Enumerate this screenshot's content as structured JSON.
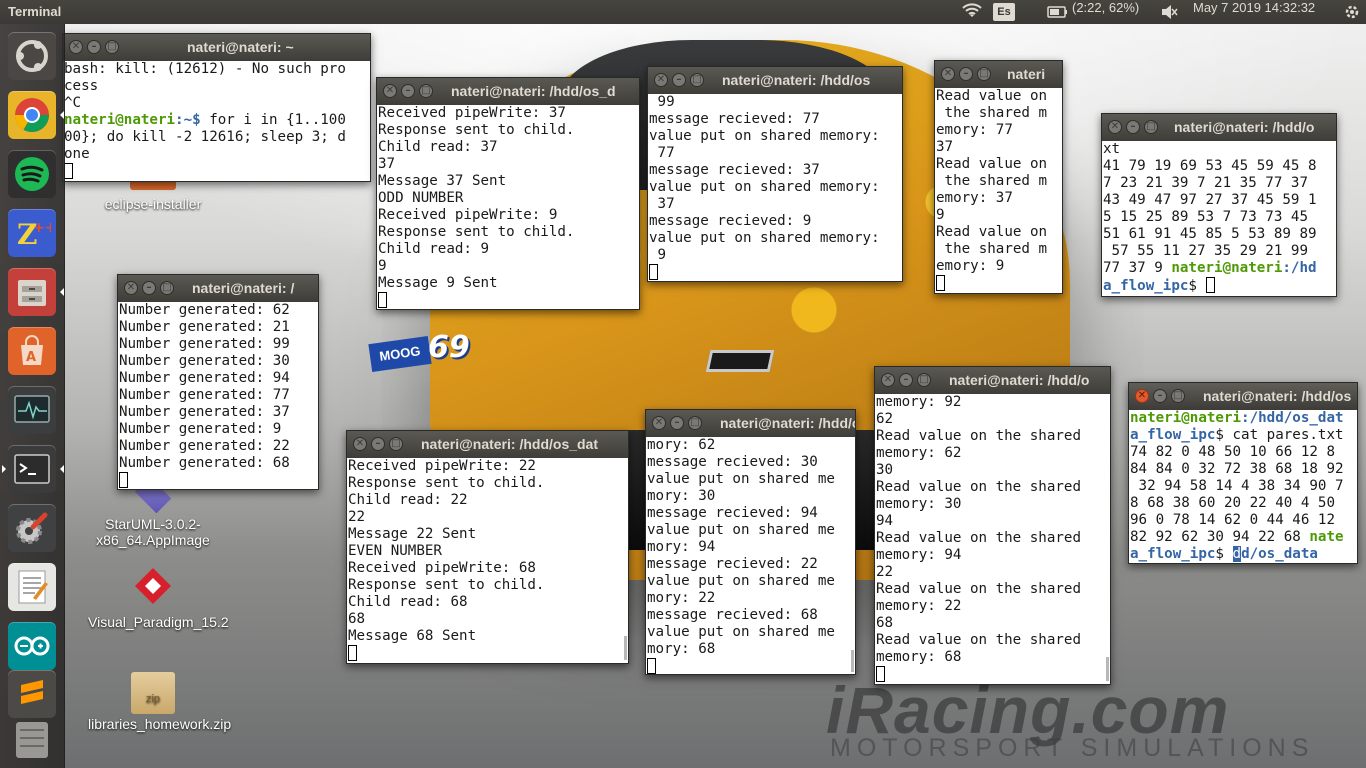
{
  "panel": {
    "app_title": "Terminal",
    "keyboard_layout": "Es",
    "battery": "(2:22, 62%)",
    "datetime": "May 7 2019 14:32:32"
  },
  "launcher": {
    "items": [
      {
        "name": "dash-home",
        "icon": "ubuntu-logo-icon"
      },
      {
        "name": "chrome",
        "icon": "chrome-icon"
      },
      {
        "name": "spotify",
        "icon": "spotify-icon"
      },
      {
        "name": "zplusplus",
        "icon": "zplusplus-icon"
      },
      {
        "name": "files",
        "icon": "file-cabinet-icon"
      },
      {
        "name": "software-center",
        "icon": "shopping-bag-icon"
      },
      {
        "name": "system-monitor",
        "icon": "system-monitor-icon"
      },
      {
        "name": "terminal",
        "icon": "terminal-icon"
      },
      {
        "name": "settings",
        "icon": "settings-wrench-icon"
      },
      {
        "name": "text-editor",
        "icon": "text-editor-icon"
      },
      {
        "name": "arduino",
        "icon": "arduino-icon"
      },
      {
        "name": "sublime",
        "icon": "sublime-icon"
      }
    ]
  },
  "desktop": {
    "icons": [
      {
        "label": "eclipse-installer"
      },
      {
        "label": "StarUML-3.0.2-x86_64.AppImage"
      },
      {
        "label": "Visual_Paradigm_15.2"
      },
      {
        "label": "libraries_homework.zip"
      },
      {
        "label": "zip"
      }
    ],
    "watermark": {
      "brand": "iRacing.com",
      "tagline": "MOTORSPORT SIMULATIONS"
    },
    "car_number": "69",
    "car_sponsor": "MOOG"
  },
  "windows": [
    {
      "title": "nateri@nateri: ~",
      "lines": [
        "bash: kill: (12612) - No such pro",
        "cess",
        "^C"
      ],
      "prompt_user": "nateri@nateri",
      "prompt_path": ":~$",
      "command_lines": [
        " for i in {1..100",
        "00}; do kill -2 12616; sleep 3; d",
        "one"
      ]
    },
    {
      "title": "nateri@nateri: /hdd/os_d",
      "lines": [
        "Received pipeWrite: 37",
        "Response sent to child.",
        "Child read: 37",
        "37",
        "Message 37 Sent",
        "ODD NUMBER",
        "Received pipeWrite: 9",
        "Response sent to child.",
        "Child read: 9",
        "9",
        "Message 9 Sent"
      ]
    },
    {
      "title": "nateri@nateri: /hdd/os",
      "lines": [
        " 99",
        "message recieved: 77",
        "value put on shared memory:",
        " 77",
        "message recieved: 37",
        "value put on shared memory:",
        " 37",
        "message recieved: 9",
        "value put on shared memory:",
        " 9"
      ]
    },
    {
      "title": "nateri",
      "lines": [
        "Read value on",
        " the shared m",
        "emory: 77",
        "37",
        "Read value on",
        " the shared m",
        "emory: 37",
        "9",
        "Read value on",
        " the shared m",
        "emory: 9"
      ]
    },
    {
      "title": "nateri@nateri: /hdd/o",
      "lines": [
        "xt",
        "41 79 19 69 53 45 59 45 8",
        "7 23 21 39 7 21 35 77 37",
        "43 49 47 97 27 37 45 59 1",
        "5 15 25 89 53 7 73 73 45",
        "51 61 91 45 85 5 53 89 89",
        " 57 55 11 27 35 29 21 99",
        "77 37 9 "
      ],
      "prompt_user": "nateri@nateri",
      "prompt_path_1": ":/hd",
      "prompt_path_2": "a_flow_ipc",
      "prompt_end": "$"
    },
    {
      "title": "nateri@nateri: /",
      "lines": [
        "Number generated: 62",
        "Number generated: 21",
        "Number generated: 99",
        "Number generated: 30",
        "Number generated: 94",
        "Number generated: 77",
        "Number generated: 37",
        "Number generated: 9",
        "Number generated: 22",
        "Number generated: 68"
      ]
    },
    {
      "title": "nateri@nateri: /hdd/os_dat",
      "lines": [
        "Received pipeWrite: 22",
        "Response sent to child.",
        "Child read: 22",
        "22",
        "Message 22 Sent",
        "EVEN NUMBER",
        "Received pipeWrite: 68",
        "Response sent to child.",
        "Child read: 68",
        "68",
        "Message 68 Sent"
      ]
    },
    {
      "title": "nateri@nateri: /hdd/o",
      "lines": [
        "mory: 62",
        "message recieved: 30",
        "value put on shared me",
        "mory: 30",
        "message recieved: 94",
        "value put on shared me",
        "mory: 94",
        "message recieved: 22",
        "value put on shared me",
        "mory: 22",
        "message recieved: 68",
        "value put on shared me",
        "mory: 68"
      ]
    },
    {
      "title": "nateri@nateri: /hdd/o",
      "lines": [
        "memory: 92",
        "62",
        "Read value on the shared",
        "memory: 62",
        "30",
        "Read value on the shared",
        "memory: 30",
        "94",
        "Read value on the shared",
        "memory: 94",
        "22",
        "Read value on the shared",
        "memory: 22",
        "68",
        "Read value on the shared",
        "memory: 68"
      ]
    },
    {
      "title": "nateri@nateri: /hdd/os",
      "prompt_user": "nateri@nateri",
      "prompt_path_1": ":/hdd/os_dat",
      "prompt_path_2": "a_flow_ipc",
      "command": " cat pares.txt",
      "lines": [
        "74 82 0 48 50 10 66 12 8",
        "84 84 0 32 72 38 68 18 92",
        " 32 94 58 14 4 38 34 90 7",
        "8 68 38 60 20 22 40 4 50",
        "96 0 78 14 62 0 44 46 12",
        "82 92 62 30 94 22 68 "
      ],
      "prompt_user_2": "nate",
      "prompt_path_3": "a_flow_ipc",
      "prompt_end": "$",
      "typed_sel": "d",
      "typed_rest": "d/os_data"
    }
  ]
}
